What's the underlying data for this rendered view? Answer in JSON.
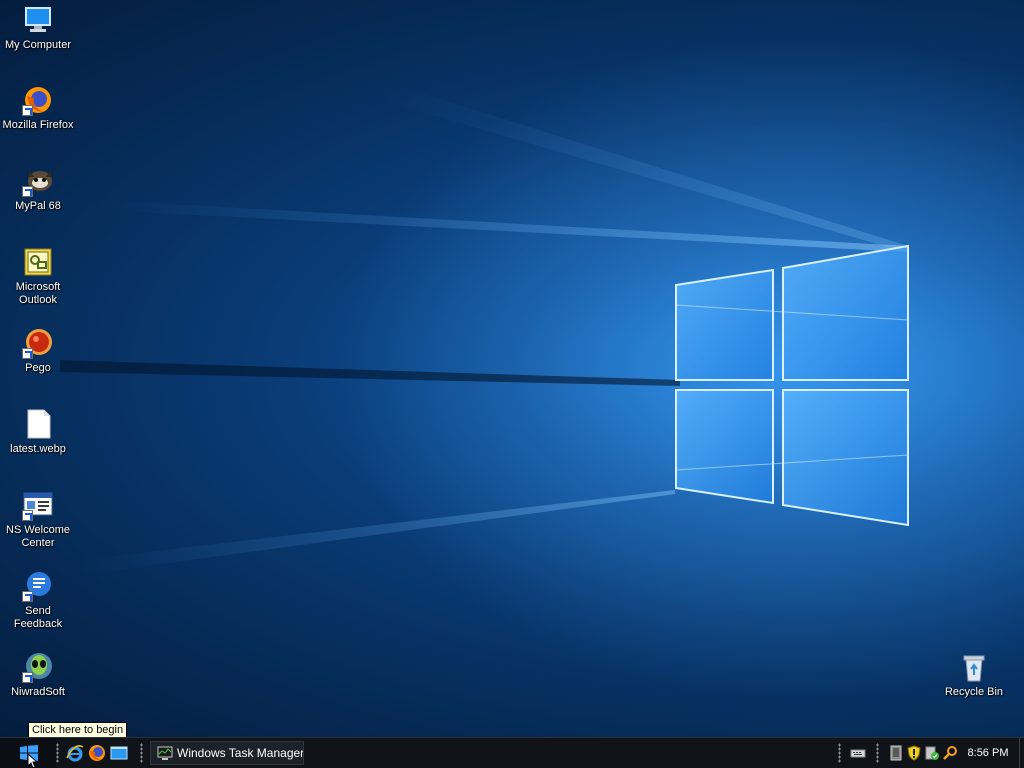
{
  "desktop": {
    "icons": [
      {
        "label": "My Computer",
        "icon": "computer-icon"
      },
      {
        "label": "Mozilla Firefox",
        "icon": "firefox-icon"
      },
      {
        "label": "MyPal 68",
        "icon": "mypal-icon"
      },
      {
        "label": "Microsoft Outlook",
        "icon": "outlook-icon"
      },
      {
        "label": "Pego",
        "icon": "pego-icon"
      },
      {
        "label": "latest.webp",
        "icon": "file-icon"
      },
      {
        "label": "NS Welcome Center",
        "icon": "welcome-center-icon"
      },
      {
        "label": "Send Feedback",
        "icon": "feedback-icon"
      },
      {
        "label": "NiwradSoft",
        "icon": "alien-icon"
      },
      {
        "label": "Recycle Bin",
        "icon": "recycle-bin-icon"
      }
    ],
    "tooltip": "Click here to begin"
  },
  "taskbar": {
    "start_icon": "windows-logo-icon",
    "quick_launch": [
      {
        "name": "Internet Explorer",
        "icon": "internet-explorer-icon"
      },
      {
        "name": "Firefox",
        "icon": "firefox-icon"
      },
      {
        "name": "Show Desktop",
        "icon": "show-desktop-icon"
      }
    ],
    "tasks": [
      {
        "label": "Windows Task Manager",
        "icon": "task-manager-icon"
      }
    ],
    "tray": {
      "icons": [
        "keyboard-icon",
        "tablet-icon",
        "security-shield-icon",
        "action-center-icon",
        "search-icon"
      ],
      "time": "8:56 PM"
    }
  },
  "colors": {
    "wallpaper_dark": "#041d3e",
    "wallpaper_light": "#1b7fd8",
    "taskbar": "#101418",
    "tooltip_bg": "#ffffe1"
  }
}
